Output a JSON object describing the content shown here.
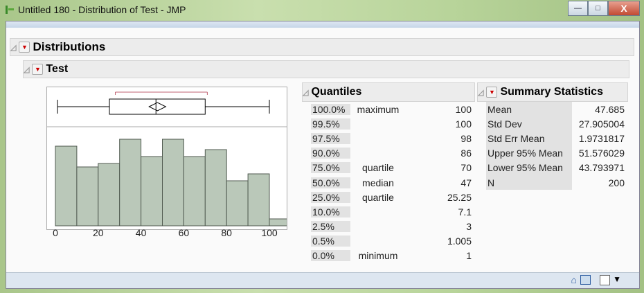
{
  "window": {
    "title": "Untitled 180 - Distribution of Test - JMP",
    "minimize": "—",
    "maximize": "□",
    "close": "X"
  },
  "distributions": {
    "title": "Distributions"
  },
  "variable": {
    "title": "Test"
  },
  "boxplot": {
    "min": 1,
    "q1": 25.25,
    "median": 47,
    "q3": 70,
    "max": 100,
    "mean": 47.685,
    "lower95": 43.793971,
    "upper95": 51.576029,
    "shortest_half": [
      28,
      71
    ]
  },
  "chart_data": {
    "type": "bar",
    "title": "Test histogram",
    "bin_edges": [
      0,
      10,
      20,
      30,
      40,
      50,
      60,
      70,
      80,
      90,
      100,
      110
    ],
    "values": [
      23,
      17,
      18,
      25,
      20,
      25,
      20,
      22,
      13,
      15,
      2
    ],
    "xlim": [
      -1,
      111
    ],
    "xticks": [
      "0",
      "20",
      "40",
      "60",
      "80",
      "100"
    ],
    "colors": {
      "bar": "#bac8b9",
      "edge": "#505a50"
    }
  },
  "quantiles": {
    "title": "Quantiles",
    "rows": [
      {
        "pct": "100.0%",
        "label": "maximum",
        "value": "100"
      },
      {
        "pct": "99.5%",
        "label": "",
        "value": "100"
      },
      {
        "pct": "97.5%",
        "label": "",
        "value": "98"
      },
      {
        "pct": "90.0%",
        "label": "",
        "value": "86"
      },
      {
        "pct": "75.0%",
        "label": "quartile",
        "value": "70"
      },
      {
        "pct": "50.0%",
        "label": "median",
        "value": "47"
      },
      {
        "pct": "25.0%",
        "label": "quartile",
        "value": "25.25"
      },
      {
        "pct": "10.0%",
        "label": "",
        "value": "7.1"
      },
      {
        "pct": "2.5%",
        "label": "",
        "value": "3"
      },
      {
        "pct": "0.5%",
        "label": "",
        "value": "1.005"
      },
      {
        "pct": "0.0%",
        "label": "minimum",
        "value": "1"
      }
    ]
  },
  "summary": {
    "title": "Summary Statistics",
    "rows": [
      {
        "label": "Mean",
        "value": "47.685"
      },
      {
        "label": "Std Dev",
        "value": "27.905004"
      },
      {
        "label": "Std Err Mean",
        "value": "1.9731817"
      },
      {
        "label": "Upper 95% Mean",
        "value": "51.576029"
      },
      {
        "label": "Lower 95% Mean",
        "value": "43.793971"
      },
      {
        "label": "N",
        "value": "200"
      }
    ]
  }
}
